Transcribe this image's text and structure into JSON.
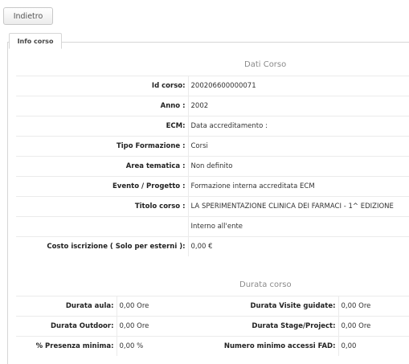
{
  "toolbar": {
    "back_label": "Indietro"
  },
  "tab": {
    "label": "Info corso"
  },
  "dati_corso": {
    "title": "Dati Corso",
    "rows": [
      {
        "label": "Id corso:",
        "value": "200206600000071"
      },
      {
        "label": "Anno :",
        "value": "2002"
      },
      {
        "label": "ECM:",
        "value": "Data accreditamento :"
      },
      {
        "label": "Tipo Formazione :",
        "value": "Corsi"
      },
      {
        "label": "Area tematica :",
        "value": "Non definito"
      },
      {
        "label": "Evento / Progetto :",
        "value": "Formazione interna accreditata ECM"
      },
      {
        "label": "Titolo corso :",
        "value": "LA SPERIMENTAZIONE CLINICA DEI FARMACI - 1^ EDIZIONE"
      },
      {
        "label": "",
        "value": "Interno all'ente"
      },
      {
        "label": "Costo iscrizione ( Solo per esterni ):",
        "value": "0,00 €"
      }
    ]
  },
  "durata_corso": {
    "title": "Durata corso",
    "rows": [
      {
        "l1": "Durata aula:",
        "v1": "0,00 Ore",
        "l2": "Durata Visite guidate:",
        "v2": "0,00 Ore"
      },
      {
        "l1": "Durata Outdoor:",
        "v1": "0,00 Ore",
        "l2": "Durata Stage/Project:",
        "v2": "0,00 Ore"
      },
      {
        "l1": "% Presenza minima:",
        "v1": "0,00 %",
        "l2": "Numero minimo accessi FAD:",
        "v2": "0,00"
      }
    ]
  }
}
